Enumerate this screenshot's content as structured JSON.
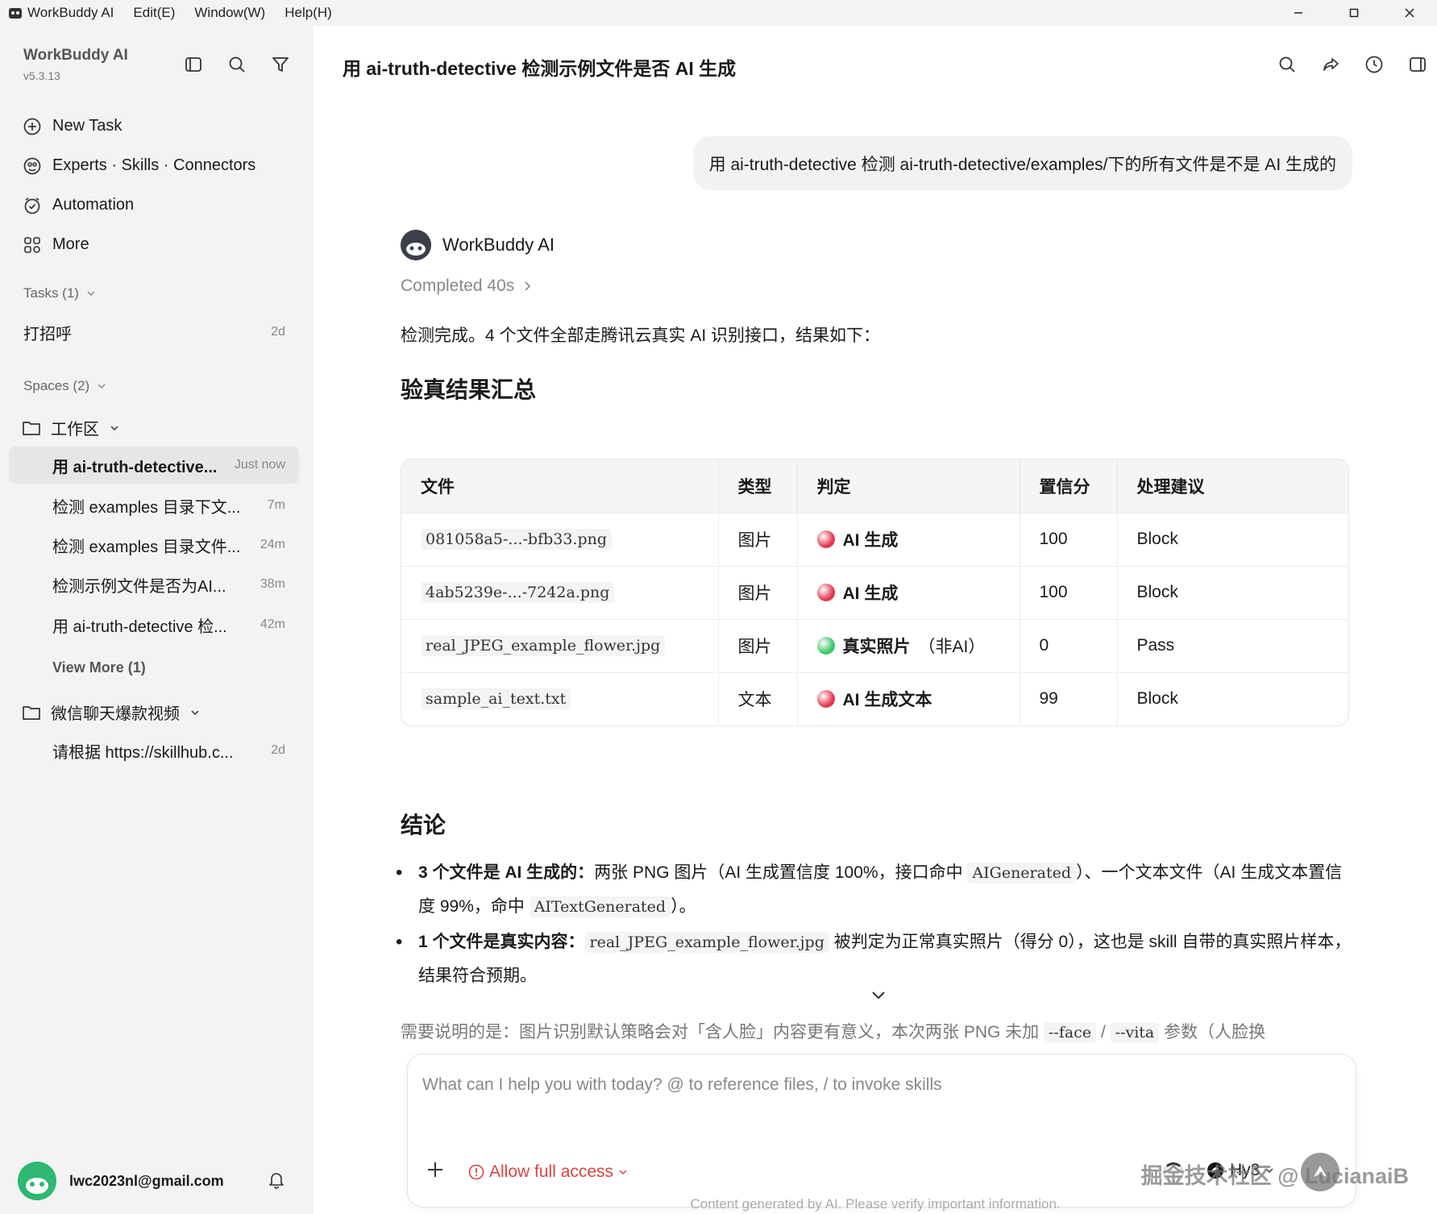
{
  "titlebar": {
    "app_name": "WorkBuddy AI",
    "menus": [
      "Edit(E)",
      "Window(W)",
      "Help(H)"
    ],
    "controls": [
      "—",
      "☐",
      "✕"
    ]
  },
  "sidebar": {
    "brand_name": "WorkBuddy AI",
    "version": "v5.3.13",
    "nav": [
      {
        "label": "New Task",
        "icon": "plus-circle-icon"
      },
      {
        "label": "Experts · Skills · Connectors",
        "icon": "experts-icon"
      },
      {
        "label": "Automation",
        "icon": "automation-icon"
      },
      {
        "label": "More",
        "icon": "grid-icon"
      }
    ],
    "tasks_header": "Tasks (1)",
    "tasks": [
      {
        "title": "打招呼",
        "time": "2d"
      }
    ],
    "spaces_header": "Spaces (2)",
    "space1": {
      "name": "工作区",
      "items": [
        {
          "title": "用 ai-truth-detective...",
          "time": "Just now"
        },
        {
          "title": "检测 examples 目录下文...",
          "time": "7m"
        },
        {
          "title": "检测 examples 目录文件...",
          "time": "24m"
        },
        {
          "title": "检测示例文件是否为AI...",
          "time": "38m"
        },
        {
          "title": "用 ai-truth-detective 检...",
          "time": "42m"
        }
      ],
      "view_more": "View More (1)"
    },
    "space2": {
      "name": "微信聊天爆款视频",
      "items": [
        {
          "title": "请根据 https://skillhub.c...",
          "time": "2d"
        }
      ]
    },
    "account_email": "lwc2023nl@gmail.com"
  },
  "main": {
    "title": "用 ai-truth-detective 检测示例文件是否 AI 生成",
    "user_message": "用 ai-truth-detective 检测 ai-truth-detective/examples/下的所有文件是不是 AI 生成的",
    "assistant_name": "WorkBuddy AI",
    "completed": "Completed 40s",
    "intro": "检测完成。4 个文件全部走腾讯云真实 AI 识别接口，结果如下：",
    "summary_heading": "验真结果汇总",
    "table": {
      "headers": [
        "文件",
        "类型",
        "判定",
        "置信分",
        "处理建议"
      ],
      "rows": [
        {
          "file": "081058a5-...-bfb33.png",
          "type": "图片",
          "verdict": "AI 生成",
          "verdict_note": "",
          "dot_color": "#e53950",
          "score": "100",
          "action": "Block"
        },
        {
          "file": "4ab5239e-...-7242a.png",
          "type": "图片",
          "verdict": "AI 生成",
          "verdict_note": "",
          "dot_color": "#e53950",
          "score": "100",
          "action": "Block"
        },
        {
          "file": "real_JPEG_example_flower.jpg",
          "type": "图片",
          "verdict": "真实照片",
          "verdict_note": "（非AI）",
          "dot_color": "#3cc86b",
          "score": "0",
          "action": "Pass"
        },
        {
          "file": "sample_ai_text.txt",
          "type": "文本",
          "verdict": "AI 生成文本",
          "verdict_note": "",
          "dot_color": "#e53950",
          "score": "99",
          "action": "Block"
        }
      ]
    },
    "conclusion_heading": "结论",
    "bullet1": {
      "bold": "3 个文件是 AI 生成的：",
      "text_a": "两张 PNG 图片（AI 生成置信度 100%，接口命中 ",
      "code_a": "AIGenerated",
      "text_b": "）、一个文本文件（AI 生成文本置信度 99%，命中 ",
      "code_b": "AITextGenerated",
      "text_c": "）。"
    },
    "bullet2": {
      "bold": "1 个文件是真实内容：",
      "code": "real_JPEG_example_flower.jpg",
      "text": " 被判定为正常真实照片（得分 0），这也是 skill 自带的真实照片样本，结果符合预期。"
    },
    "note": {
      "text_a": "需要说明的是：图片识别默认策略会对「含人脸」内容更有意义，本次两张 PNG 未加 ",
      "code_a": "--face",
      "sep": " / ",
      "code_b": "--vita",
      "text_b": " 参数（人脸换"
    },
    "composer": {
      "placeholder": "What can I help you with today? @ to reference files, / to invoke skills",
      "access_label": "Allow full access",
      "model": "Hy3"
    },
    "disclaimer": "Content generated by AI. Please verify important information.",
    "watermark": "掘金技术社区 @ LucianaiB"
  }
}
